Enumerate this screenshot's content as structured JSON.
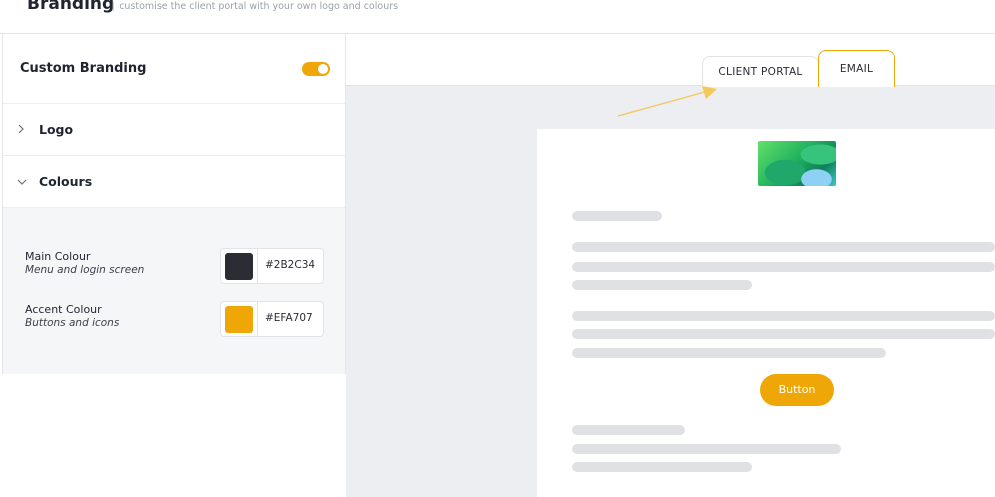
{
  "header": {
    "title": "Branding",
    "separator": "|",
    "subtitle": "customise the client portal with your own logo and colours"
  },
  "settings": {
    "custom_branding": {
      "label": "Custom Branding",
      "enabled": true
    },
    "sections": [
      {
        "label": "Logo",
        "expanded": false,
        "icon": "chevron-right-icon"
      },
      {
        "label": "Colours",
        "expanded": true,
        "icon": "chevron-down-icon"
      }
    ],
    "colours": {
      "main": {
        "name": "Main Colour",
        "description": "Menu and login screen",
        "hex": "#2B2C34"
      },
      "accent": {
        "name": "Accent Colour",
        "description": "Buttons and icons",
        "hex": "#EFA707"
      }
    }
  },
  "preview": {
    "tabs": [
      {
        "label": "CLIENT PORTAL",
        "active": false
      },
      {
        "label": "EMAIL",
        "active": true
      }
    ],
    "email": {
      "button_label": "Button"
    }
  },
  "colors": {
    "accent": "#EFA707",
    "main": "#2B2C34",
    "placeholder": "#DFE1E5"
  }
}
